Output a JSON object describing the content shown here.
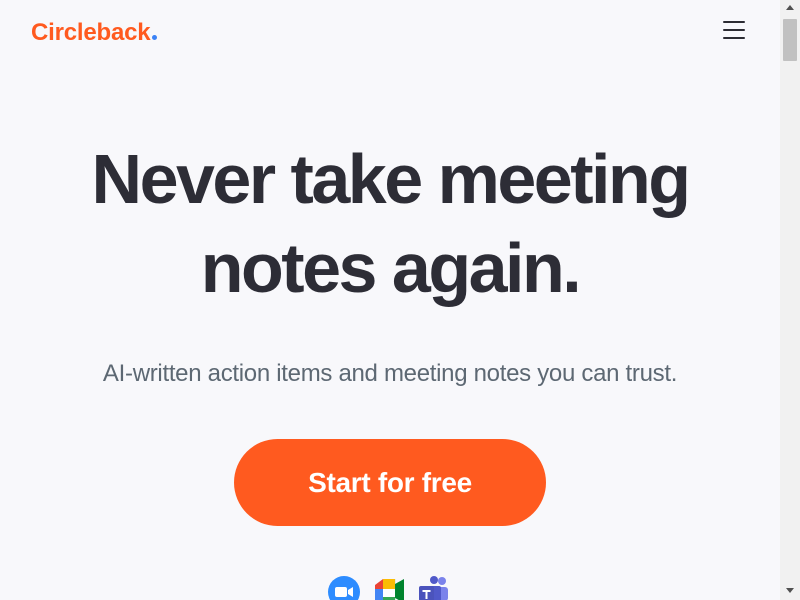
{
  "header": {
    "logo_text": "Circleback",
    "logo_dot_color": "#3b82f6",
    "menu_icon": "hamburger-menu-icon"
  },
  "hero": {
    "title_line_1": "Never take meeting",
    "title_line_2": "notes again.",
    "subtitle": "AI-written action items and meeting notes you can trust."
  },
  "cta": {
    "label": "Start for free",
    "color": "#ff5a1f"
  },
  "integrations": {
    "icons": [
      "zoom-icon",
      "google-meet-icon",
      "microsoft-teams-icon"
    ]
  },
  "colors": {
    "brand": "#ff5a1f",
    "heading": "#2d2d36",
    "subtitle": "#5d6873",
    "background": "#f8f8fb"
  }
}
